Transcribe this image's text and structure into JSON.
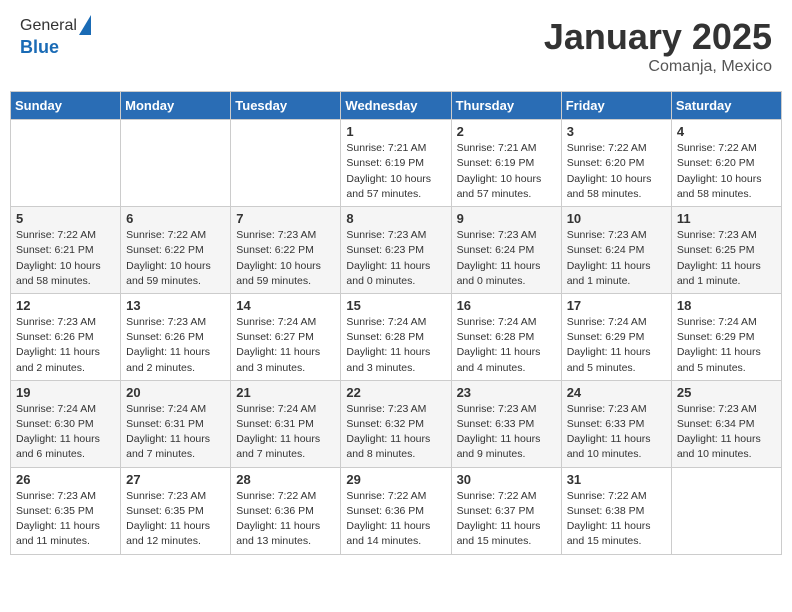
{
  "header": {
    "logo_line1": "General",
    "logo_line2": "Blue",
    "month": "January 2025",
    "location": "Comanja, Mexico"
  },
  "weekdays": [
    "Sunday",
    "Monday",
    "Tuesday",
    "Wednesday",
    "Thursday",
    "Friday",
    "Saturday"
  ],
  "weeks": [
    [
      {
        "day": "",
        "info": ""
      },
      {
        "day": "",
        "info": ""
      },
      {
        "day": "",
        "info": ""
      },
      {
        "day": "1",
        "info": "Sunrise: 7:21 AM\nSunset: 6:19 PM\nDaylight: 10 hours\nand 57 minutes."
      },
      {
        "day": "2",
        "info": "Sunrise: 7:21 AM\nSunset: 6:19 PM\nDaylight: 10 hours\nand 57 minutes."
      },
      {
        "day": "3",
        "info": "Sunrise: 7:22 AM\nSunset: 6:20 PM\nDaylight: 10 hours\nand 58 minutes."
      },
      {
        "day": "4",
        "info": "Sunrise: 7:22 AM\nSunset: 6:20 PM\nDaylight: 10 hours\nand 58 minutes."
      }
    ],
    [
      {
        "day": "5",
        "info": "Sunrise: 7:22 AM\nSunset: 6:21 PM\nDaylight: 10 hours\nand 58 minutes."
      },
      {
        "day": "6",
        "info": "Sunrise: 7:22 AM\nSunset: 6:22 PM\nDaylight: 10 hours\nand 59 minutes."
      },
      {
        "day": "7",
        "info": "Sunrise: 7:23 AM\nSunset: 6:22 PM\nDaylight: 10 hours\nand 59 minutes."
      },
      {
        "day": "8",
        "info": "Sunrise: 7:23 AM\nSunset: 6:23 PM\nDaylight: 11 hours\nand 0 minutes."
      },
      {
        "day": "9",
        "info": "Sunrise: 7:23 AM\nSunset: 6:24 PM\nDaylight: 11 hours\nand 0 minutes."
      },
      {
        "day": "10",
        "info": "Sunrise: 7:23 AM\nSunset: 6:24 PM\nDaylight: 11 hours\nand 1 minute."
      },
      {
        "day": "11",
        "info": "Sunrise: 7:23 AM\nSunset: 6:25 PM\nDaylight: 11 hours\nand 1 minute."
      }
    ],
    [
      {
        "day": "12",
        "info": "Sunrise: 7:23 AM\nSunset: 6:26 PM\nDaylight: 11 hours\nand 2 minutes."
      },
      {
        "day": "13",
        "info": "Sunrise: 7:23 AM\nSunset: 6:26 PM\nDaylight: 11 hours\nand 2 minutes."
      },
      {
        "day": "14",
        "info": "Sunrise: 7:24 AM\nSunset: 6:27 PM\nDaylight: 11 hours\nand 3 minutes."
      },
      {
        "day": "15",
        "info": "Sunrise: 7:24 AM\nSunset: 6:28 PM\nDaylight: 11 hours\nand 3 minutes."
      },
      {
        "day": "16",
        "info": "Sunrise: 7:24 AM\nSunset: 6:28 PM\nDaylight: 11 hours\nand 4 minutes."
      },
      {
        "day": "17",
        "info": "Sunrise: 7:24 AM\nSunset: 6:29 PM\nDaylight: 11 hours\nand 5 minutes."
      },
      {
        "day": "18",
        "info": "Sunrise: 7:24 AM\nSunset: 6:29 PM\nDaylight: 11 hours\nand 5 minutes."
      }
    ],
    [
      {
        "day": "19",
        "info": "Sunrise: 7:24 AM\nSunset: 6:30 PM\nDaylight: 11 hours\nand 6 minutes."
      },
      {
        "day": "20",
        "info": "Sunrise: 7:24 AM\nSunset: 6:31 PM\nDaylight: 11 hours\nand 7 minutes."
      },
      {
        "day": "21",
        "info": "Sunrise: 7:24 AM\nSunset: 6:31 PM\nDaylight: 11 hours\nand 7 minutes."
      },
      {
        "day": "22",
        "info": "Sunrise: 7:23 AM\nSunset: 6:32 PM\nDaylight: 11 hours\nand 8 minutes."
      },
      {
        "day": "23",
        "info": "Sunrise: 7:23 AM\nSunset: 6:33 PM\nDaylight: 11 hours\nand 9 minutes."
      },
      {
        "day": "24",
        "info": "Sunrise: 7:23 AM\nSunset: 6:33 PM\nDaylight: 11 hours\nand 10 minutes."
      },
      {
        "day": "25",
        "info": "Sunrise: 7:23 AM\nSunset: 6:34 PM\nDaylight: 11 hours\nand 10 minutes."
      }
    ],
    [
      {
        "day": "26",
        "info": "Sunrise: 7:23 AM\nSunset: 6:35 PM\nDaylight: 11 hours\nand 11 minutes."
      },
      {
        "day": "27",
        "info": "Sunrise: 7:23 AM\nSunset: 6:35 PM\nDaylight: 11 hours\nand 12 minutes."
      },
      {
        "day": "28",
        "info": "Sunrise: 7:22 AM\nSunset: 6:36 PM\nDaylight: 11 hours\nand 13 minutes."
      },
      {
        "day": "29",
        "info": "Sunrise: 7:22 AM\nSunset: 6:36 PM\nDaylight: 11 hours\nand 14 minutes."
      },
      {
        "day": "30",
        "info": "Sunrise: 7:22 AM\nSunset: 6:37 PM\nDaylight: 11 hours\nand 15 minutes."
      },
      {
        "day": "31",
        "info": "Sunrise: 7:22 AM\nSunset: 6:38 PM\nDaylight: 11 hours\nand 15 minutes."
      },
      {
        "day": "",
        "info": ""
      }
    ]
  ]
}
